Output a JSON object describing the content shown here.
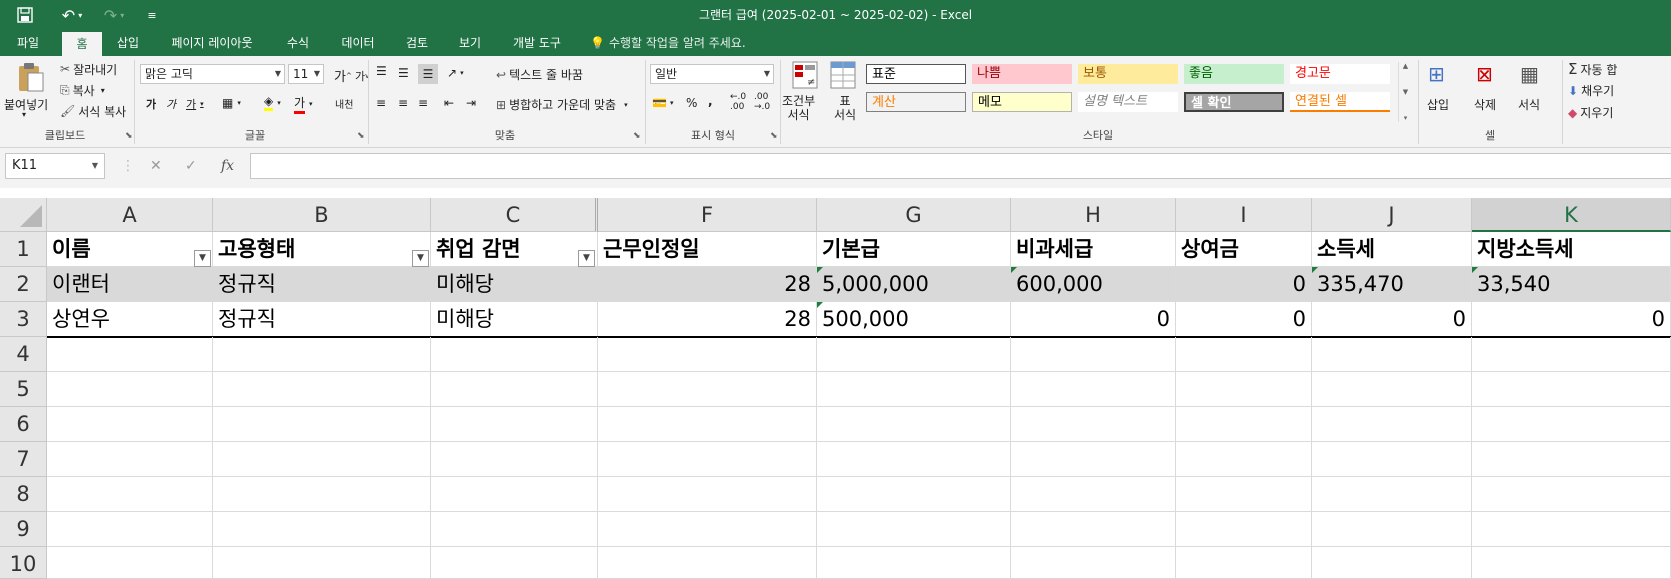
{
  "window": {
    "title": "그랜터 급여 (2025-02-01 ~ 2025-02-02) - Excel"
  },
  "menu": {
    "tabs": [
      "파일",
      "홈",
      "삽입",
      "페이지 레이아웃",
      "수식",
      "데이터",
      "검토",
      "보기",
      "개발 도구"
    ],
    "active_tab": "홈",
    "tell_me": "수행할 작업을 알려 주세요."
  },
  "ribbon": {
    "clipboard": {
      "label": "클립보드",
      "paste": "붙여넣기",
      "cut": "잘라내기",
      "copy": "복사",
      "format_painter": "서식 복사"
    },
    "font": {
      "label": "글꼴",
      "font_name": "맑은 고딕",
      "font_size": "11",
      "grow": "가",
      "shrink": "가",
      "bold": "가",
      "italic": "가",
      "underline": "가",
      "font_color": "가",
      "phonetic": "내천"
    },
    "alignment": {
      "label": "맞춤",
      "wrap_text": "텍스트 줄 바꿈",
      "merge_center": "병합하고 가운데 맞춤"
    },
    "number": {
      "label": "표시 형식",
      "format": "일반",
      "percent": "%",
      "comma": ",",
      "inc_decimal": "←.0\n.00",
      "dec_decimal": ".00\n→.0"
    },
    "styles": {
      "label": "스타일",
      "conditional": "조건부\n서식",
      "format_table": "표\n서식",
      "cells": [
        {
          "name": "표준",
          "bg": "#ffffff",
          "fg": "#000000"
        },
        {
          "name": "나쁨",
          "bg": "#ffc7ce",
          "fg": "#9c0006"
        },
        {
          "name": "보통",
          "bg": "#ffeb9c",
          "fg": "#9c5700"
        },
        {
          "name": "좋음",
          "bg": "#c6efce",
          "fg": "#006100"
        },
        {
          "name": "경고문",
          "bg": "#ffffff",
          "fg": "#ff0000"
        },
        {
          "name": "계산",
          "bg": "#f2f2f2",
          "fg": "#fa7d00"
        },
        {
          "name": "메모",
          "bg": "#ffffcc",
          "fg": "#000000"
        },
        {
          "name": "설명 텍스트",
          "bg": "#ffffff",
          "fg": "#7f7f7f"
        },
        {
          "name": "셀 확인",
          "bg": "#a5a5a5",
          "fg": "#ffffff"
        },
        {
          "name": "연결된 셀",
          "bg": "#ffffff",
          "fg": "#fa7d00"
        }
      ]
    },
    "cells": {
      "label": "셀",
      "insert": "삽입",
      "delete": "삭제",
      "format": "서식"
    },
    "editing": {
      "autosum": "자동 합",
      "fill": "채우기",
      "clear": "지우기"
    }
  },
  "formula_bar": {
    "name_box": "K11",
    "fx": "fx",
    "value": ""
  },
  "sheet": {
    "columns": [
      "A",
      "B",
      "C",
      "F",
      "G",
      "H",
      "I",
      "J",
      "K"
    ],
    "selected_column": "K",
    "row_numbers": [
      "1",
      "2",
      "3",
      "4",
      "5",
      "6",
      "7",
      "8",
      "9",
      "10"
    ],
    "header_row": [
      "이름",
      "고용형태",
      "취업 감면",
      "근무인정일",
      "기본급",
      "비과세급",
      "상여금",
      "소득세",
      "지방소득세"
    ],
    "rows": [
      [
        "이랜터",
        "정규직",
        "미해당",
        "28",
        "5,000,000",
        "600,000",
        "0",
        "335,470",
        "33,540"
      ],
      [
        "상연우",
        "정규직",
        "미해당",
        "28",
        "500,000",
        "0",
        "0",
        "0",
        "0"
      ]
    ]
  },
  "colors": {
    "excel_green": "#217346",
    "row_highlight": "#d9d9d9"
  }
}
